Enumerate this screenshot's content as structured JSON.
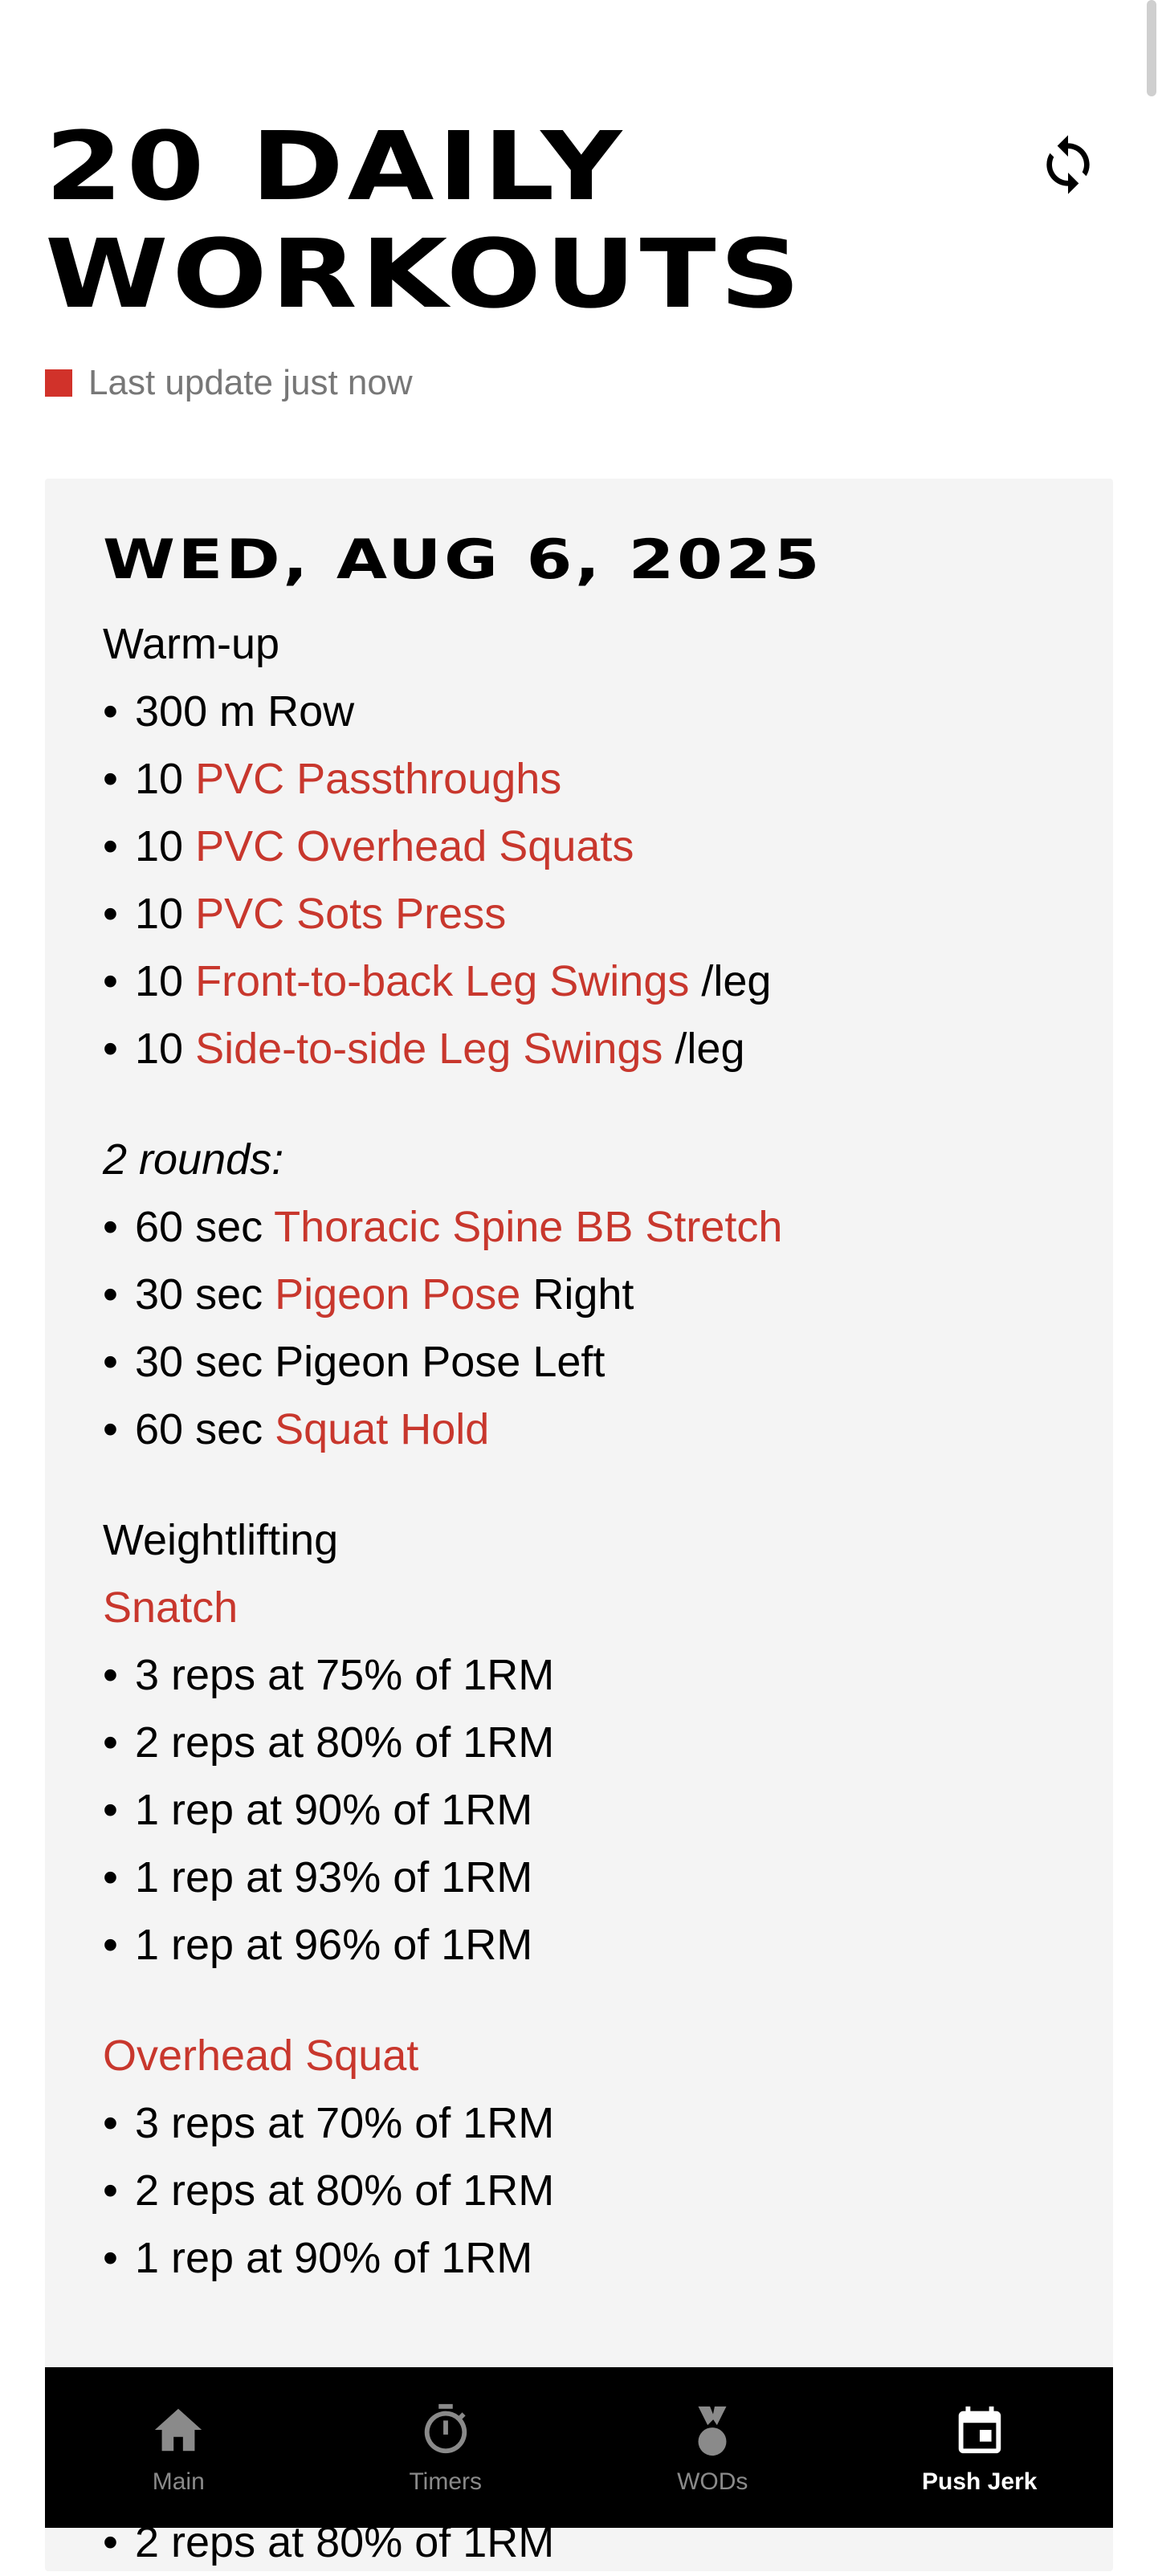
{
  "header": {
    "title_line1": "20 DAILY",
    "title_line2": "WORKOUTS",
    "refresh_icon": "refresh-icon",
    "status_text": "Last update just now",
    "status_color": "#d1322a"
  },
  "workout": {
    "date": "WED, AUG 6, 2025",
    "warmup_heading": "Warm-up",
    "warmup": [
      {
        "bullet": "•",
        "pre": "300 m Row",
        "link": "",
        "post": ""
      },
      {
        "bullet": "•",
        "pre": "10 ",
        "link": "PVC Passthroughs",
        "post": ""
      },
      {
        "bullet": "•",
        "pre": "10 ",
        "link": "PVC Overhead Squats",
        "post": ""
      },
      {
        "bullet": "•",
        "pre": "10 ",
        "link": "PVC Sots Press",
        "post": ""
      },
      {
        "bullet": "•",
        "pre": "10 ",
        "link": "Front-to-back Leg Swings",
        "post": " /leg"
      },
      {
        "bullet": "•",
        "pre": "10 ",
        "link": "Side-to-side Leg Swings",
        "post": " /leg"
      }
    ],
    "rounds_label": "2 rounds:",
    "rounds": [
      {
        "bullet": "•",
        "pre": "60 sec ",
        "link": "Thoracic Spine BB Stretch",
        "post": ""
      },
      {
        "bullet": "•",
        "pre": "30 sec ",
        "link": "Pigeon Pose",
        "post": " Right"
      },
      {
        "bullet": "•",
        "pre": "30 sec Pigeon Pose Left",
        "link": "",
        "post": ""
      },
      {
        "bullet": "•",
        "pre": "60 sec ",
        "link": "Squat Hold",
        "post": ""
      }
    ],
    "weightlifting_heading": "Weightlifting",
    "snatch_label": "Snatch",
    "snatch": [
      {
        "bullet": "•",
        "text": "3 reps at 75% of 1RM"
      },
      {
        "bullet": "•",
        "text": "2 reps at 80% of 1RM"
      },
      {
        "bullet": "•",
        "text": "1 rep at 90% of 1RM"
      },
      {
        "bullet": "•",
        "text": "1 rep at 93% of 1RM"
      },
      {
        "bullet": "•",
        "text": "1 rep at 96% of 1RM"
      }
    ],
    "ohs_label": "Overhead Squat",
    "ohs": [
      {
        "bullet": "•",
        "text": "3 reps at 70% of 1RM"
      },
      {
        "bullet": "•",
        "text": "2 reps at 80% of 1RM"
      },
      {
        "bullet": "•",
        "text": "1 rep at 90% of 1RM"
      }
    ],
    "peek": {
      "bullet": "•",
      "text": "2 reps at 80% of 1RM"
    },
    "link_color": "#c8372d"
  },
  "nav": {
    "items": [
      {
        "label": "Main",
        "icon": "home-icon"
      },
      {
        "label": "Timers",
        "icon": "stopwatch-icon"
      },
      {
        "label": "WODs",
        "icon": "medal-icon"
      },
      {
        "label": "Push Jerk",
        "icon": "calendar-icon"
      }
    ],
    "active_index": 3
  }
}
